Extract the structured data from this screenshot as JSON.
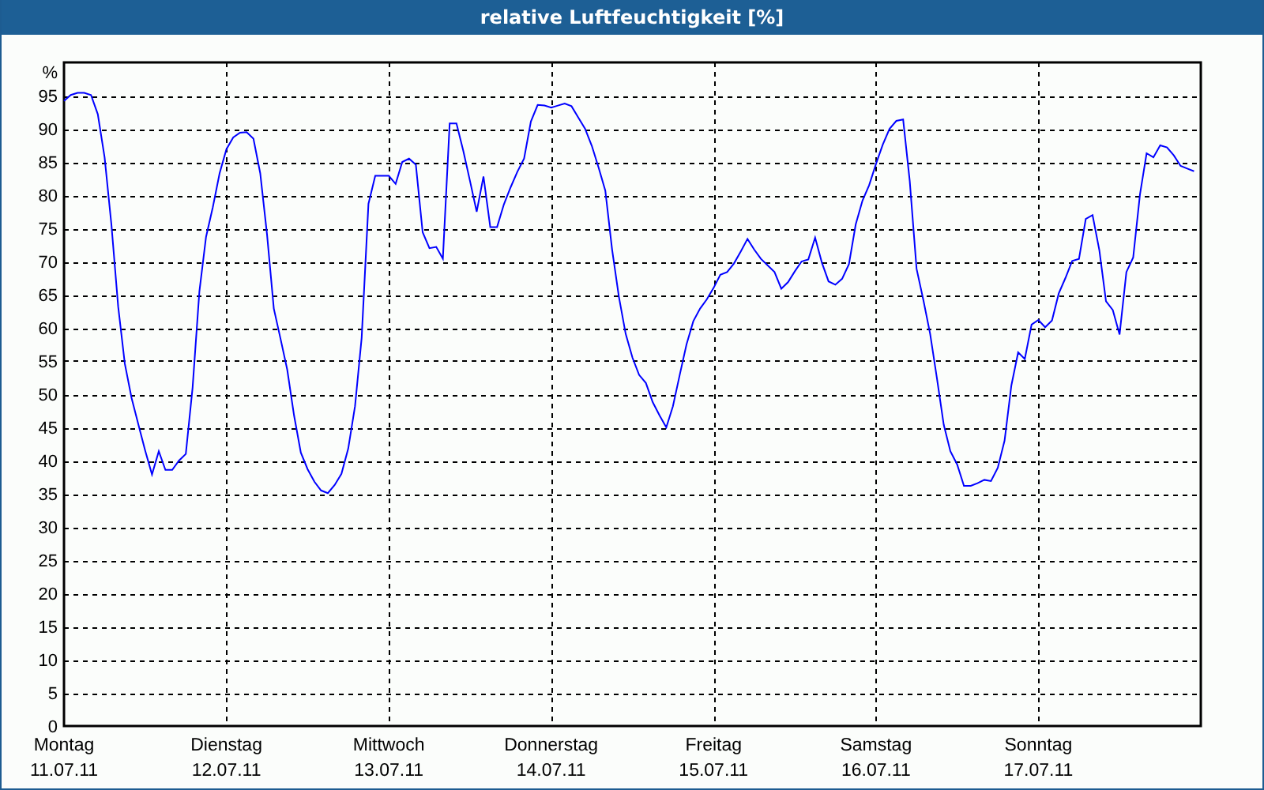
{
  "chart_data": {
    "type": "line",
    "grid": true,
    "title": "relative Luftfeuchtigkeit [%]",
    "ylabel": "%",
    "ylim": [
      0,
      100
    ],
    "yticks": [
      0,
      5,
      10,
      15,
      20,
      25,
      30,
      35,
      40,
      45,
      50,
      55,
      60,
      65,
      70,
      75,
      80,
      85,
      90,
      95
    ],
    "categories": [
      "Montag 11.07.11",
      null,
      null,
      null,
      null,
      null,
      null,
      null,
      null,
      null,
      null,
      null,
      null,
      null,
      null,
      null,
      null,
      null,
      null,
      null,
      null,
      null,
      null,
      null,
      "Dienstag 12.07.11",
      null,
      null,
      null,
      null,
      null,
      null,
      null,
      null,
      null,
      null,
      null,
      null,
      null,
      null,
      null,
      null,
      null,
      null,
      null,
      null,
      null,
      null,
      null,
      "Mittwoch 13.07.11",
      null,
      null,
      null,
      null,
      null,
      null,
      null,
      null,
      null,
      null,
      null,
      null,
      null,
      null,
      null,
      null,
      null,
      null,
      null,
      null,
      null,
      null,
      null,
      "Donnerstag 14.07.11",
      null,
      null,
      null,
      null,
      null,
      null,
      null,
      null,
      null,
      null,
      null,
      null,
      null,
      null,
      null,
      null,
      null,
      null,
      null,
      null,
      null,
      null,
      null,
      "Freitag 15.07.11",
      null,
      null,
      null,
      null,
      null,
      null,
      null,
      null,
      null,
      null,
      null,
      null,
      null,
      null,
      null,
      null,
      null,
      null,
      null,
      null,
      null,
      null,
      null,
      "Samstag 16.07.11",
      null,
      null,
      null,
      null,
      null,
      null,
      null,
      null,
      null,
      null,
      null,
      null,
      null,
      null,
      null,
      null,
      null,
      null,
      null,
      null,
      null,
      null,
      null,
      "Sonntag 17.07.11",
      null,
      null,
      null,
      null,
      null,
      null,
      null,
      null,
      null,
      null,
      null,
      null,
      null,
      null,
      null,
      null,
      null,
      null,
      null,
      null,
      null,
      null,
      null,
      null
    ],
    "series": [
      {
        "color": "#0000ff",
        "values": [
          94.2,
          95.1,
          95.4,
          95.4,
          95.1,
          92.2,
          85.7,
          75.6,
          63.2,
          54.6,
          49.4,
          45.4,
          41.5,
          37.9,
          41.4,
          38.6,
          38.6,
          40,
          41,
          51,
          65.5,
          73.7,
          78.2,
          83.3,
          86.9,
          88.7,
          89.4,
          89.5,
          88.5,
          83.3,
          74.1,
          62.9,
          58.4,
          53.7,
          46.8,
          41.2,
          38.7,
          36.8,
          35.5,
          35.1,
          36.3,
          38,
          41.8,
          48.2,
          58.5,
          78.7,
          82.9,
          82.9,
          82.9,
          81.7,
          85,
          85.5,
          84.6,
          74.4,
          72,
          72.2,
          70.4,
          90.8,
          90.8,
          86.7,
          82.1,
          77.5,
          82.8,
          75.2,
          75.2,
          78.6,
          81.2,
          83.5,
          85.5,
          91.1,
          93.6,
          93.5,
          93.2,
          93.5,
          93.8,
          93.4,
          91.7,
          90,
          87.4,
          84.2,
          80.7,
          71.8,
          64.7,
          59.1,
          55.5,
          52.9,
          51.7,
          48.8,
          46.8,
          45,
          48.2,
          52.9,
          57.5,
          61,
          62.9,
          64.3,
          66,
          68,
          68.4,
          69.7,
          71.5,
          73.4,
          71.8,
          70.4,
          69.4,
          68.4,
          65.9,
          66.9,
          68.5,
          70,
          70.3,
          73.6,
          69.8,
          67,
          66.5,
          67.4,
          69.6,
          75.6,
          79.2,
          81.5,
          84.7,
          87.6,
          90,
          91.2,
          91.4,
          82.1,
          68.9,
          64.2,
          59.1,
          52.4,
          45.4,
          41.4,
          39.4,
          36.2,
          36.2,
          36.6,
          37.1,
          36.9,
          38.9,
          43,
          51.3,
          56.3,
          55.3,
          60.5,
          61.2,
          60.1,
          61.1,
          65.2,
          67.5,
          70.1,
          70.4,
          76.4,
          77,
          71.7,
          64,
          62.7,
          59,
          68.4,
          70.6,
          80.1,
          86.3,
          85.7,
          87.5,
          87.2,
          86,
          84.4,
          84,
          83.6,
          null
        ]
      }
    ]
  }
}
